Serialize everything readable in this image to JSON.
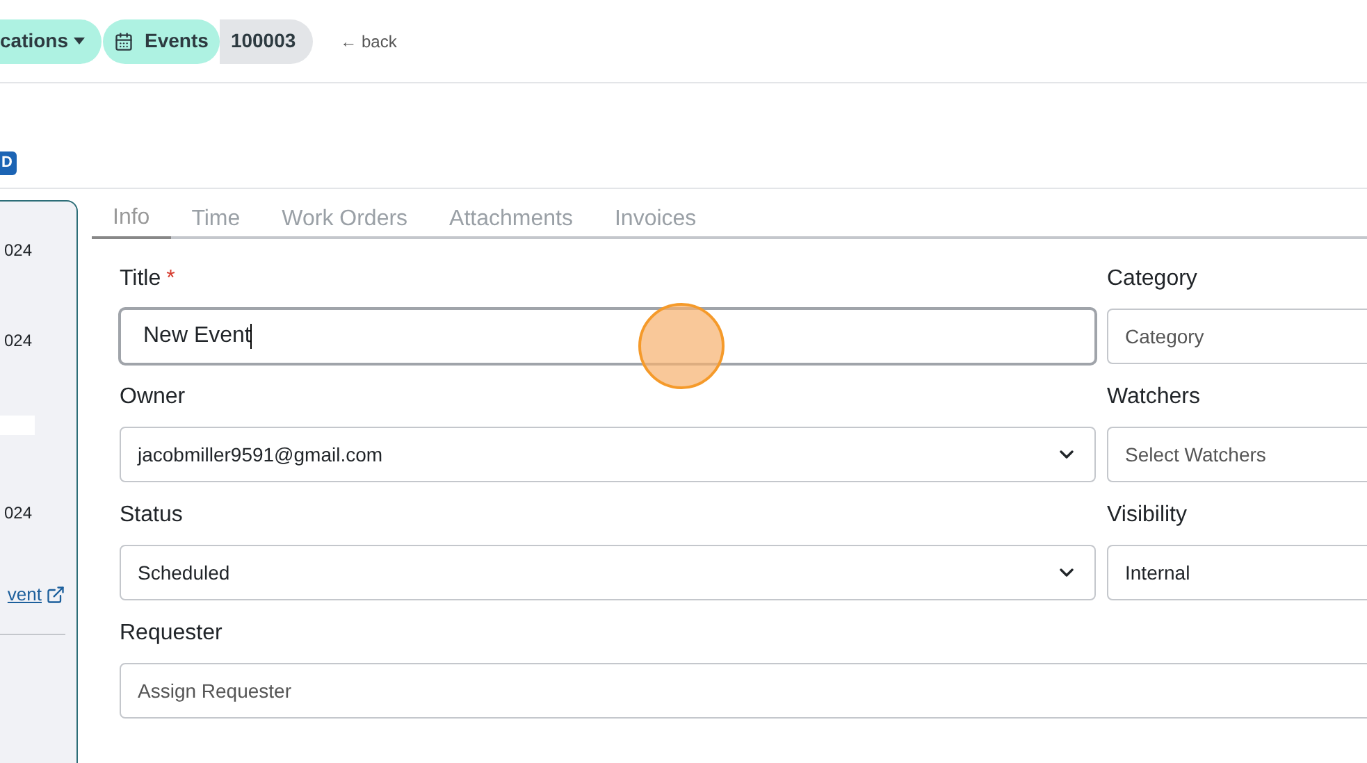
{
  "breadcrumbs": [
    {
      "label": "cations",
      "kind": "dropdown"
    },
    {
      "label": "Events",
      "kind": "icon"
    },
    {
      "label": "100003",
      "kind": "plain"
    }
  ],
  "back": "← back",
  "badge": "D",
  "side_panel": {
    "items": [
      {
        "kind": "text",
        "text": "024"
      },
      {
        "kind": "text",
        "text": "024"
      },
      {
        "kind": "bar"
      },
      {
        "kind": "text",
        "text": "024"
      },
      {
        "kind": "link",
        "text": "vent"
      }
    ]
  },
  "tabs": [
    {
      "label": "Info",
      "selected": true
    },
    {
      "label": "Time",
      "selected": false
    },
    {
      "label": "Work Orders",
      "selected": false
    },
    {
      "label": "Attachments",
      "selected": false
    },
    {
      "label": "Invoices",
      "selected": false
    }
  ],
  "rows": [
    {
      "main": {
        "label": "Title",
        "required_mark": "*",
        "kind": "text",
        "value": "New Event",
        "focused": true
      },
      "side": {
        "label": "Category",
        "placeholder": "Category"
      }
    },
    {
      "main": {
        "label": "Owner",
        "kind": "select",
        "value": "jacobmiller9591@gmail.com",
        "focused": false
      },
      "side": {
        "label": "Watchers",
        "placeholder": "Select Watchers"
      }
    },
    {
      "main": {
        "label": "Status",
        "kind": "select",
        "value": "Scheduled",
        "focused": false
      },
      "side": {
        "label": "Visibility",
        "value": "Internal"
      }
    },
    {
      "main": {
        "label": "Requester",
        "kind": "text",
        "placeholder": "Assign Requester",
        "focused": false
      }
    }
  ]
}
